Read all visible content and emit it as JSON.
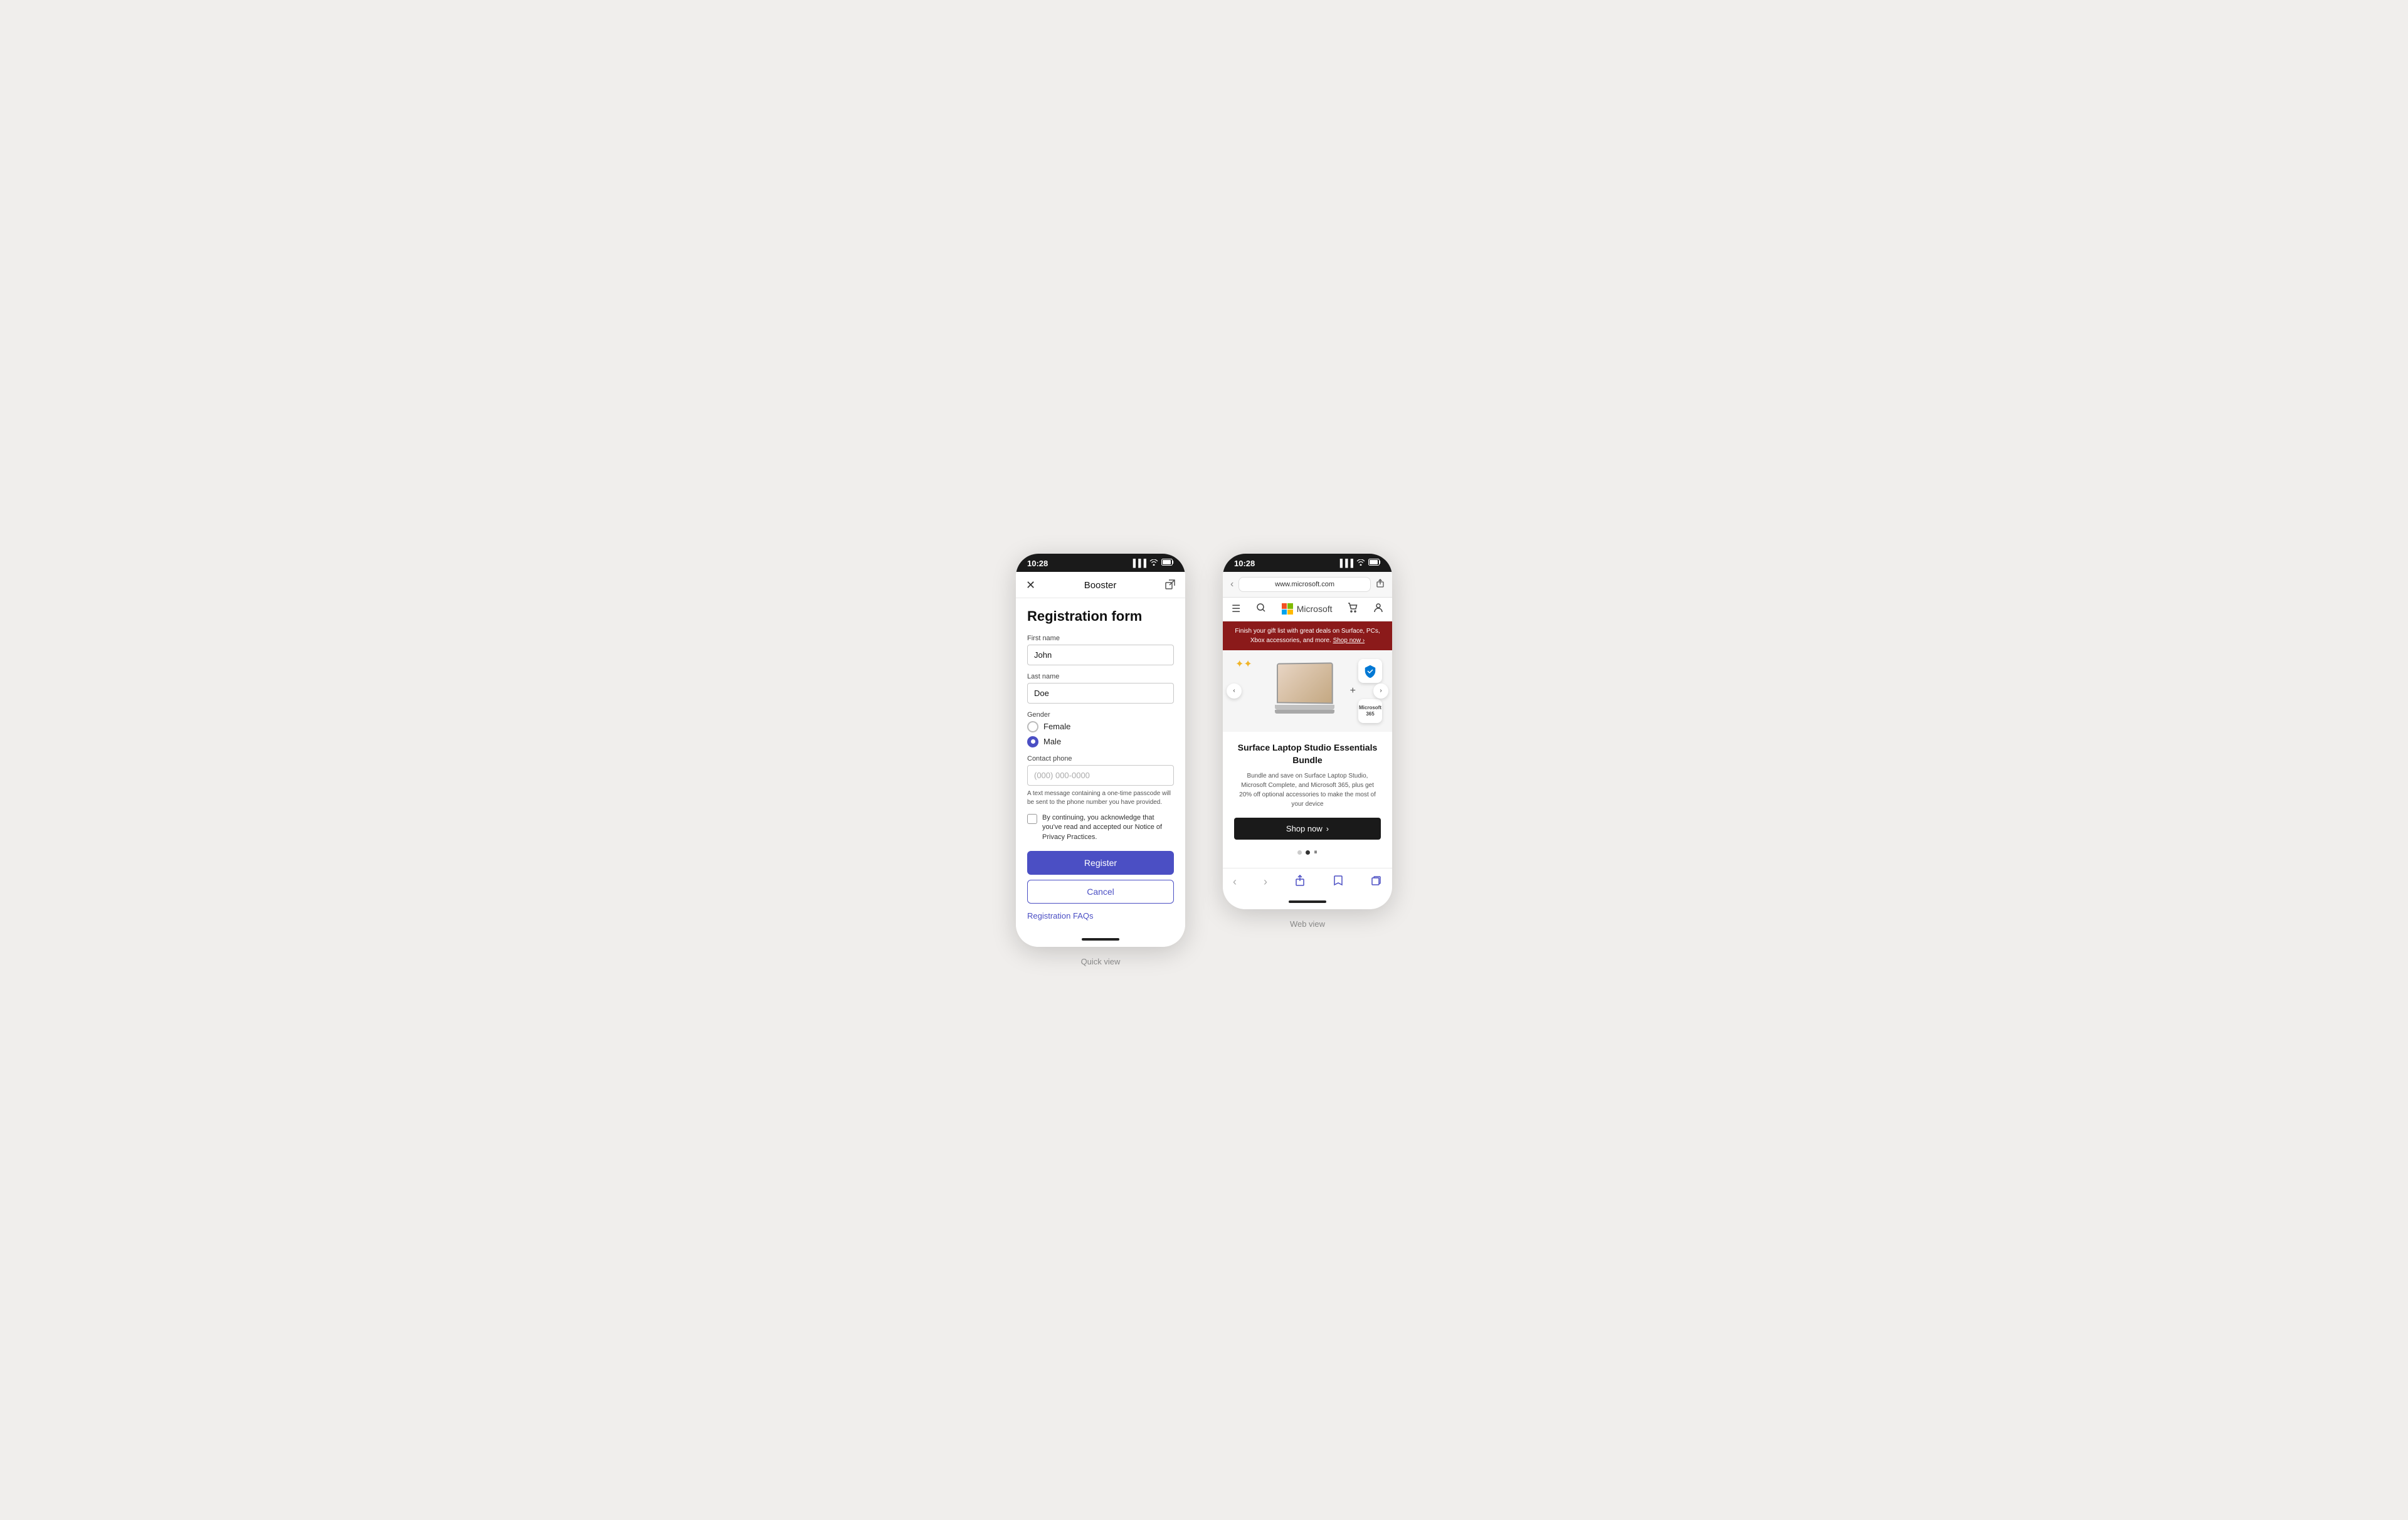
{
  "page": {
    "background": "#f0eeec"
  },
  "quickview": {
    "label": "Quick view",
    "status_time": "10:28",
    "header_title": "Booster",
    "form_title": "Registration form",
    "first_name_label": "First name",
    "first_name_value": "John",
    "last_name_label": "Last name",
    "last_name_value": "Doe",
    "gender_label": "Gender",
    "gender_female": "Female",
    "gender_male": "Male",
    "contact_label": "Contact phone",
    "contact_placeholder": "(000) 000-0000",
    "sms_notice": "A text message containing a one-time passcode will be sent to the phone number you have provided.",
    "privacy_text": "By continuing, you acknowledge that you've read and accepted our Notice of Privacy Practices.",
    "register_btn": "Register",
    "cancel_btn": "Cancel",
    "faq_link": "Registration FAQs"
  },
  "webview": {
    "label": "Web view",
    "status_time": "10:28",
    "url": "www.microsoft.com",
    "promo_text": "Finish your gift list with great deals on Surface, PCs, Xbox accessories, and more. Shop now",
    "product_title": "Surface Laptop Studio Essentials Bundle",
    "product_desc": "Bundle and save on Surface Laptop Studio, Microsoft Complete, and Microsoft 365, plus get 20% off optional accessories to make the most of your device",
    "shop_btn": "Shop now",
    "ms_brand": "Microsoft",
    "badge2_label": "Microsoft 365"
  }
}
